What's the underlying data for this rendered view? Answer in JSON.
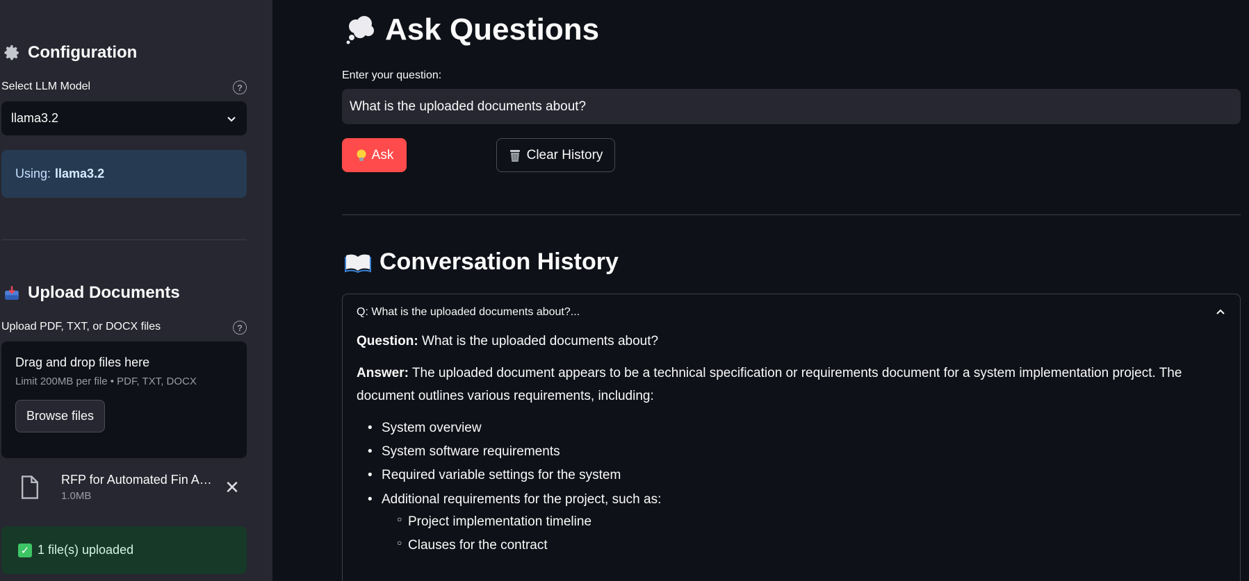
{
  "sidebar": {
    "config_heading": "Configuration",
    "config_icon": "gear-icon",
    "model_label": "Select LLM Model",
    "model_selected": "llama3.2",
    "info_prefix": "Using:",
    "info_model": "llama3.2",
    "upload_heading": "Upload Documents",
    "upload_icon": "inbox-tray-icon",
    "upload_label": "Upload PDF, TXT, or DOCX files",
    "dropzone": {
      "title": "Drag and drop files here",
      "limit": "Limit 200MB per file • PDF, TXT, DOCX",
      "browse_label": "Browse files"
    },
    "file": {
      "name": "RFP for Automated Fin A…",
      "size": "1.0MB"
    },
    "success_text": "1 file(s) uploaded"
  },
  "main": {
    "title": "Ask Questions",
    "title_icon": "thought-balloon-icon",
    "question_label": "Enter your question:",
    "question_value": "What is the uploaded documents about?",
    "ask_label": "Ask",
    "clear_label": "Clear History",
    "history_title": "Conversation History",
    "history_icon": "open-book-icon",
    "expander_header": "Q: What is the uploaded documents about?...",
    "question_prefix": "Question:",
    "question_text": "What is the uploaded documents about?",
    "answer_prefix": "Answer:",
    "answer_text": "The uploaded document appears to be a technical specification or requirements document for a system implementation project. The document outlines various requirements, including:",
    "bullets": [
      "System overview",
      "System software requirements",
      "Required variable settings for the system",
      "Additional requirements for the project, such as:"
    ],
    "sub_bullets": [
      "Project implementation timeline",
      "Clauses for the contract"
    ]
  },
  "colors": {
    "sidebar_bg": "#262730",
    "main_bg": "#0e1117",
    "primary_button": "#ff4b4b",
    "info_bg": "#263a52",
    "success_bg": "#173928"
  }
}
